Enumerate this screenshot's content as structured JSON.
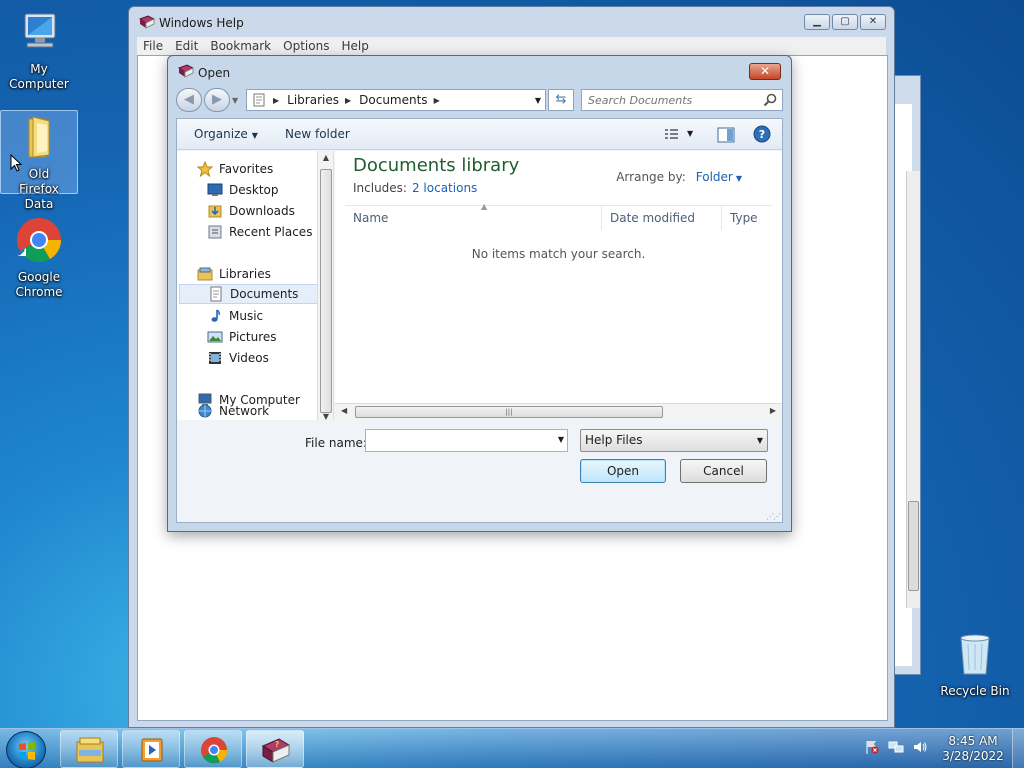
{
  "desktop": {
    "icons": [
      {
        "label": "My Computer"
      },
      {
        "label": "Old Firefox Data"
      },
      {
        "label": "Google Chrome"
      },
      {
        "label": "Recycle Bin"
      }
    ]
  },
  "help_window": {
    "title": "Windows Help",
    "menu": [
      "File",
      "Edit",
      "Bookmark",
      "Options",
      "Help"
    ]
  },
  "dialog": {
    "title": "Open",
    "breadcrumb": [
      "Libraries",
      "Documents"
    ],
    "search_placeholder": "Search Documents",
    "toolbar": {
      "organize": "Organize",
      "new_folder": "New folder"
    },
    "nav": {
      "favorites": "Favorites",
      "favorites_items": [
        "Desktop",
        "Downloads",
        "Recent Places"
      ],
      "libraries": "Libraries",
      "libraries_items": [
        "Documents",
        "Music",
        "Pictures",
        "Videos"
      ],
      "computer": "My Computer",
      "network": "Network",
      "selected": "Documents"
    },
    "library": {
      "title": "Documents library",
      "includes_label": "Includes:",
      "includes_link": "2 locations",
      "arrange_label": "Arrange by:",
      "arrange_value": "Folder"
    },
    "columns": [
      "Name",
      "Date modified",
      "Type"
    ],
    "empty_message": "No items match your search.",
    "file_name_label": "File name:",
    "file_name_value": "",
    "file_type": "Help Files",
    "open_button": "Open",
    "cancel_button": "Cancel"
  },
  "taskbar": {
    "time": "8:45 AM",
    "date": "3/28/2022"
  }
}
